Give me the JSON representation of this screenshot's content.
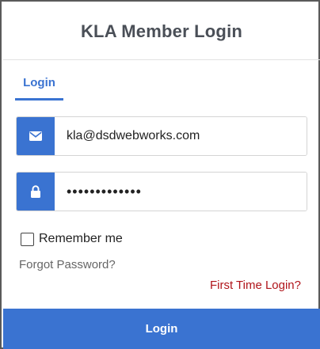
{
  "header": {
    "title": "KLA Member Login"
  },
  "tabs": [
    {
      "label": "Login",
      "active": true
    }
  ],
  "form": {
    "email": {
      "value": "kla@dsdwebworks.com",
      "icon": "envelope-icon"
    },
    "password": {
      "value": "•••••••••••••",
      "icon": "lock-icon"
    },
    "remember_label": "Remember me",
    "remember_checked": false,
    "forgot_label": "Forgot Password?",
    "first_time_label": "First Time Login?",
    "submit_label": "Login"
  },
  "colors": {
    "accent": "#3a73d1",
    "title": "#4a4f57",
    "first_time_link": "#b0141a",
    "muted_link": "#666666"
  }
}
